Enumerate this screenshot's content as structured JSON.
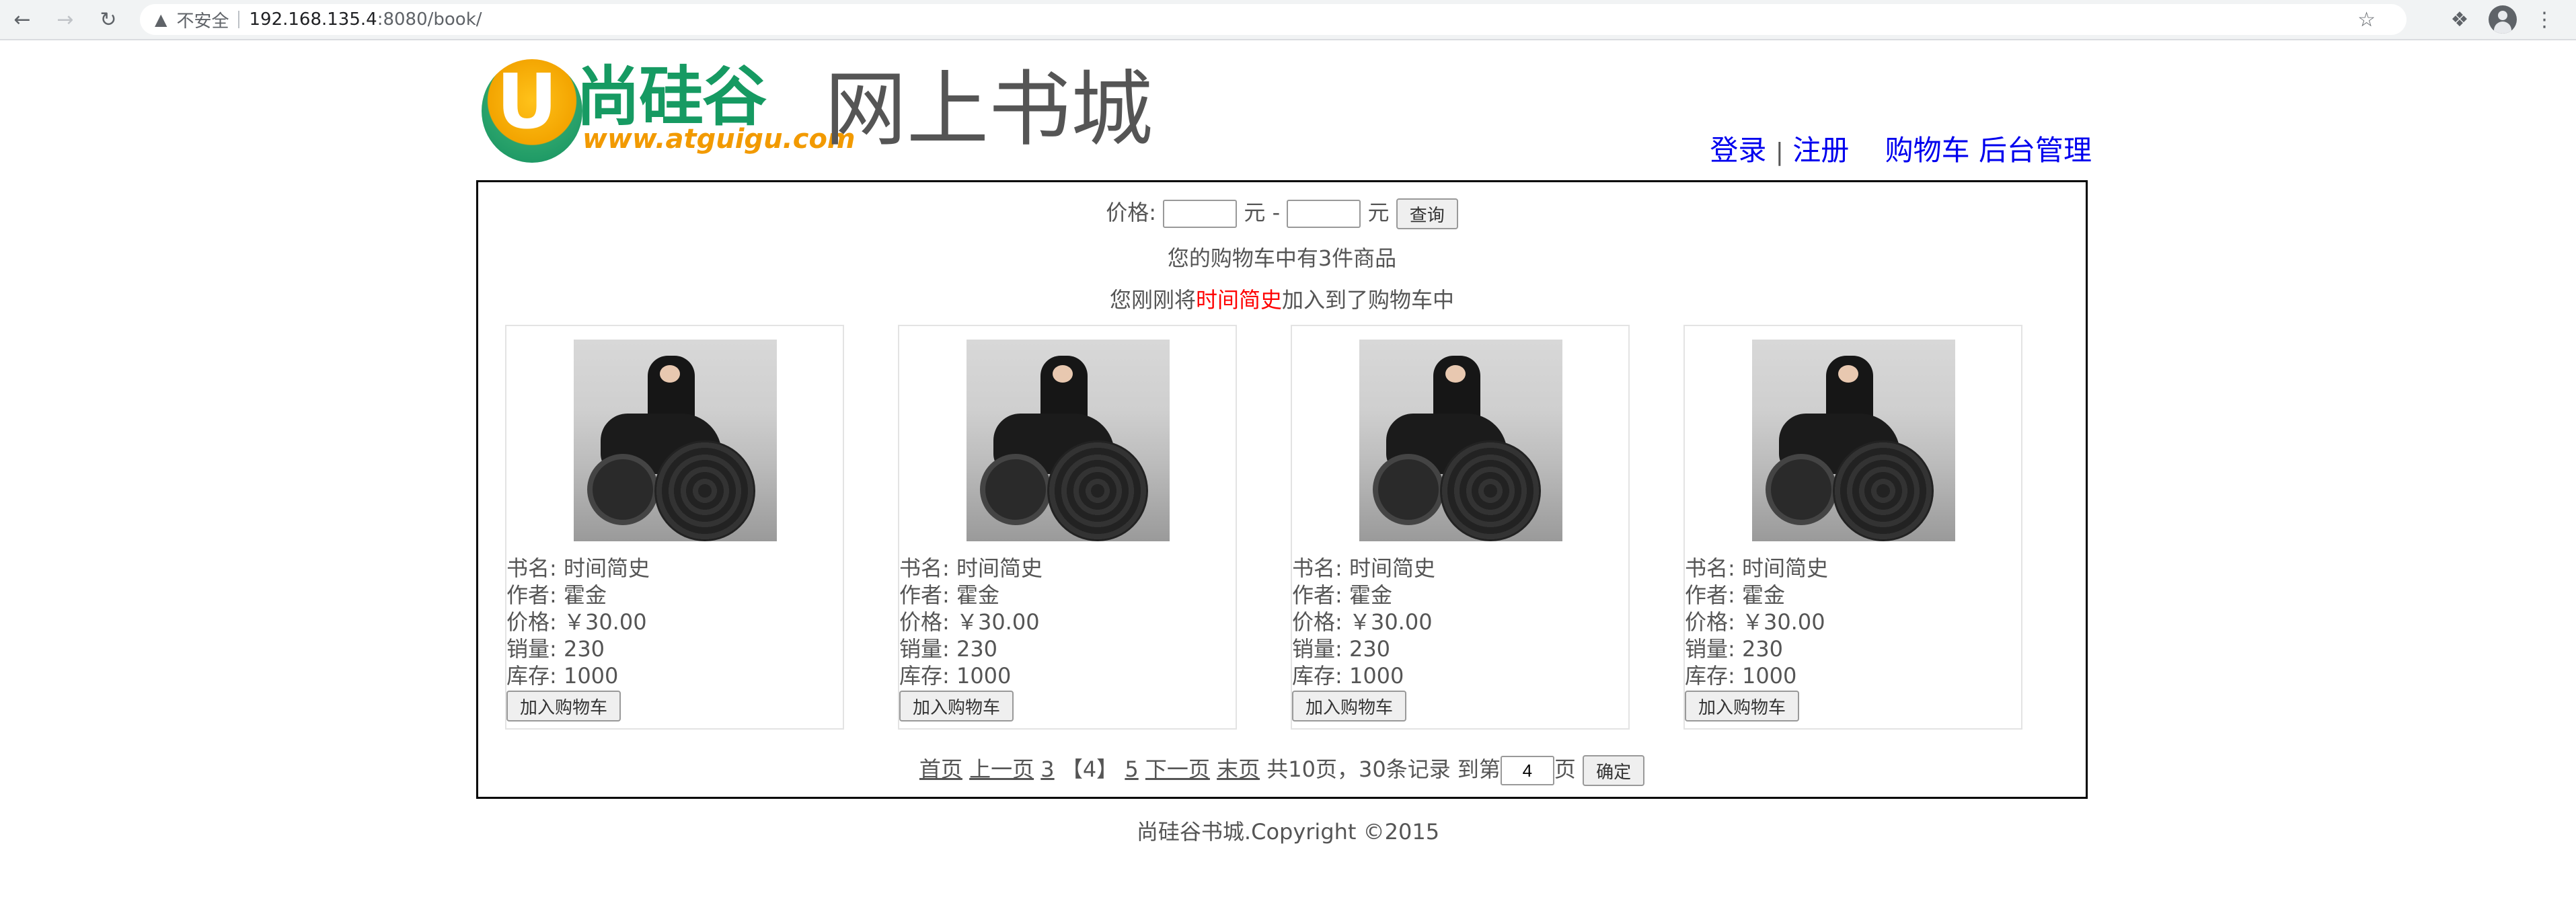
{
  "browser": {
    "insecure_label": "不安全",
    "url_host": "192.168.135.4",
    "url_path": ":8080/book/"
  },
  "header": {
    "logo_cn": "尚硅谷",
    "logo_url": "www.atguigu.com",
    "site_title": "网上书城",
    "links": {
      "login": "登录",
      "separator": "|",
      "register": "注册",
      "cart": "购物车",
      "admin": "后台管理"
    }
  },
  "search": {
    "price_label": "价格:",
    "unit1": "元 -",
    "unit2": "元",
    "query_button": "查询"
  },
  "cart_message": "您的购物车中有3件商品",
  "added": {
    "prefix": "您刚刚将",
    "book": "时间简史",
    "suffix": "加入到了购物车中"
  },
  "books": [
    {
      "name": "书名: 时间简史",
      "author": "作者: 霍金",
      "price": "价格: ￥30.00",
      "sales": "销量: 230",
      "stock": "库存: 1000",
      "button": "加入购物车"
    },
    {
      "name": "书名: 时间简史",
      "author": "作者: 霍金",
      "price": "价格: ￥30.00",
      "sales": "销量: 230",
      "stock": "库存: 1000",
      "button": "加入购物车"
    },
    {
      "name": "书名: 时间简史",
      "author": "作者: 霍金",
      "price": "价格: ￥30.00",
      "sales": "销量: 230",
      "stock": "库存: 1000",
      "button": "加入购物车"
    },
    {
      "name": "书名: 时间简史",
      "author": "作者: 霍金",
      "price": "价格: ￥30.00",
      "sales": "销量: 230",
      "stock": "库存: 1000",
      "button": "加入购物车"
    }
  ],
  "pager": {
    "first": "首页",
    "prev": "上一页",
    "page_prev_num": "3",
    "current": "【4】",
    "page_next_num": "5",
    "next": "下一页",
    "last": "末页",
    "summary": "共10页，30条记录 到第",
    "goto_value": "4",
    "page_unit": "页",
    "confirm_button": "确定"
  },
  "footer": "尚硅谷书城.Copyright ©2015"
}
